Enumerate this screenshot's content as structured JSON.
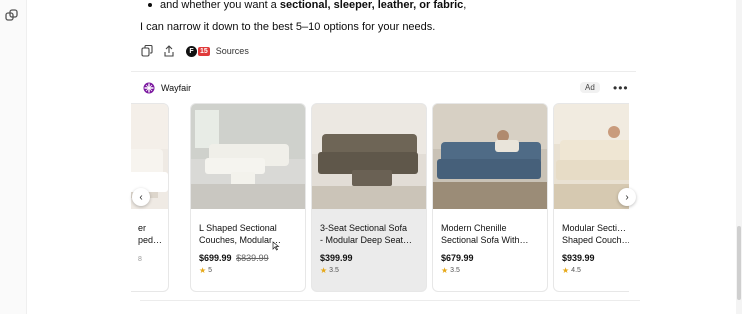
{
  "bullet": {
    "prefix": "and whether you want a ",
    "bold": "sectional, sleeper, leather, or fabric",
    "suffix": ","
  },
  "narrow_text": "I can narrow it down to the best 5–10 options for your needs.",
  "actions": {
    "copy_icon": "copy-icon",
    "share_icon": "share-icon",
    "sources_badge_letter": "F",
    "sources_badge_count": "15",
    "sources_label": "Sources"
  },
  "ad": {
    "brand_name": "Wayfair",
    "ad_label": "Ad",
    "more_label": "•••",
    "prev_label": "‹",
    "next_label": "›",
    "products": [
      {
        "title": "er\nped…",
        "price": "",
        "old_price": "",
        "rating": "",
        "partial": "left"
      },
      {
        "title": "L Shaped Sectional\nCouches, Modular…",
        "price": "$699.99",
        "old_price": "$839.99",
        "rating": "5"
      },
      {
        "title": "3-Seat Sectional Sofa\n- Modular Deep Seat…",
        "price": "$399.99",
        "old_price": "",
        "rating": "3.5"
      },
      {
        "title": "Modern Chenille\nSectional Sofa With…",
        "price": "$679.99",
        "old_price": "",
        "rating": "3.5"
      },
      {
        "title": "Modular Secti…\nShaped Couch…",
        "price": "$939.99",
        "old_price": "",
        "rating": "4.5"
      }
    ]
  },
  "colors": {
    "star": "#e6a817",
    "wayfair_purple": "#7b189f"
  }
}
